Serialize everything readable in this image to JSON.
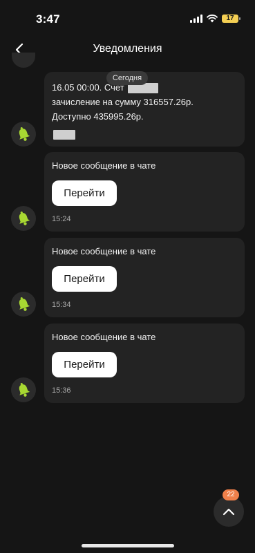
{
  "status_bar": {
    "time": "3:47",
    "battery": "17"
  },
  "header": {
    "title": "Уведомления"
  },
  "day_label": "Сегодня",
  "notifications": [
    {
      "line1_prefix": "16.05 00:00. Счет",
      "line2": "зачисление на сумму 316557.26р.",
      "line3": "Доступно 435995.26р."
    },
    {
      "title": "Новое сообщение в чате",
      "button": "Перейти",
      "time": "15:24"
    },
    {
      "title": "Новое сообщение в чате",
      "button": "Перейти",
      "time": "15:34"
    },
    {
      "title": "Новое сообщение в чате",
      "button": "Перейти",
      "time": "15:36"
    }
  ],
  "scroll_badge": "22",
  "colors": {
    "background": "#151515",
    "card": "#232323",
    "bell": "#a8d832",
    "badge": "#f0804a"
  }
}
